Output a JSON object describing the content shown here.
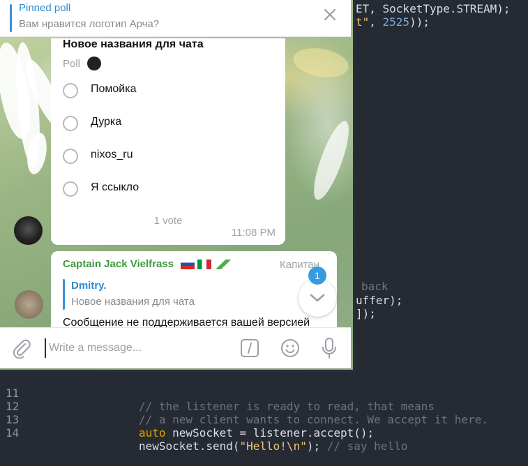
{
  "editor": {
    "top_lines": [
      {
        "text_a": "ET, SocketType.STREAM);"
      },
      {
        "str": "t\"",
        "plain": ", ",
        "num": "2525",
        "tail": "));"
      }
    ],
    "mid_lines": [
      {
        "text": "back",
        "cls": "cm"
      },
      {
        "text": "uffer);",
        "cls": "plain"
      },
      {
        "text": "]);",
        "cls": "plain"
      }
    ],
    "brace": "{",
    "lines": [
      {
        "num": "11",
        "comment": "// the listener is ready to read, that means"
      },
      {
        "num": "12",
        "comment": "// a new client wants to connect. We accept it here."
      },
      {
        "num": "13",
        "kw": "auto",
        "code": " newSocket = listener.accept();"
      },
      {
        "num": "14",
        "code": "newSocket.send(",
        "str": "\"Hello!\\n\"",
        "code2": "); ",
        "comment": "// say hello"
      }
    ]
  },
  "telegram": {
    "pinned": {
      "title": "Pinned poll",
      "subtitle": "Вам нравится логотип Арча?",
      "close_icon": "close-icon"
    },
    "poll": {
      "question": "Новое названия для чата",
      "type_label": "Poll",
      "options": [
        "Помойка",
        "Дурка",
        "nixos_ru",
        "Я ссыкло"
      ],
      "votes": "1 vote",
      "time": "11:08 PM"
    },
    "message": {
      "sender": "Captain Jack Vielfrass",
      "rank": "Капитан",
      "reply_name": "Dmitry.",
      "reply_text": "Новое названия для чата",
      "text": "Сообщение не поддерживается вашей версией"
    },
    "unread_badge": "1",
    "composer": {
      "placeholder": "Write a message..."
    },
    "colors": {
      "accent": "#2b8ad3",
      "sender": "#3d9a3d",
      "badge": "#3a9ae0"
    }
  }
}
